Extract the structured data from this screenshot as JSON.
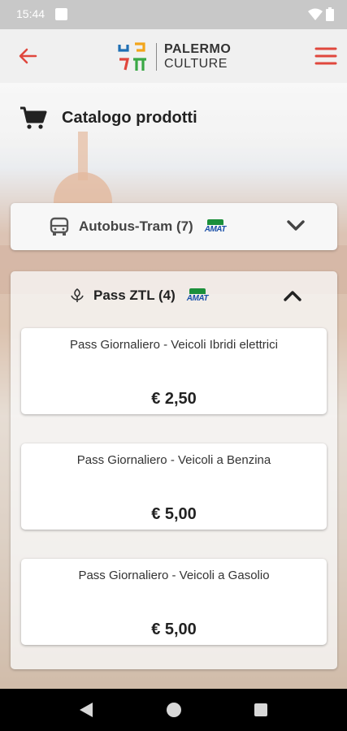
{
  "status_bar": {
    "time": "15:44"
  },
  "app_bar": {
    "logo_line1": "PALERMO",
    "logo_line2": "CULTURE",
    "back_icon": "arrow-left-icon",
    "menu_icon": "hamburger-menu-icon",
    "accent_color": "#e0473d"
  },
  "catalog": {
    "title": "Catalogo prodotti",
    "icon": "cart-icon"
  },
  "categories": [
    {
      "label": "Autobus-Tram (7)",
      "icon": "bus-icon",
      "logo_text": "AMAT",
      "state": "collapsed"
    },
    {
      "label": "Pass ZTL (4)",
      "icon": "leaf-icon",
      "logo_text": "AMAT",
      "state": "expanded"
    }
  ],
  "products": [
    {
      "name": "Pass Giornaliero - Veicoli Ibridi elettrici",
      "price": "€ 2,50"
    },
    {
      "name": "Pass Giornaliero - Veicoli a Benzina",
      "price": "€ 5,00"
    },
    {
      "name": "Pass Giornaliero - Veicoli a Gasolio",
      "price": "€ 5,00"
    }
  ]
}
